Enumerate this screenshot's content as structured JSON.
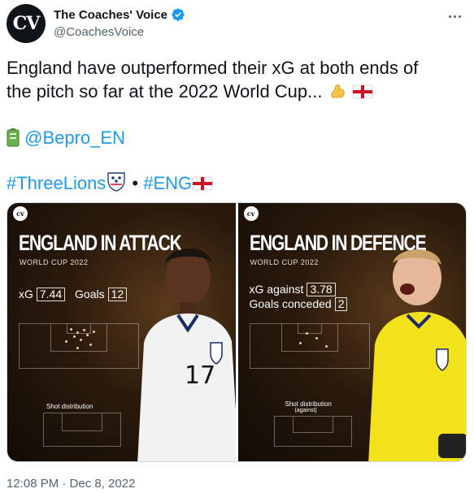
{
  "author": {
    "avatar_text": "CV",
    "display_name": "The Coaches' Voice",
    "handle": "@CoachesVoice"
  },
  "tweet": {
    "line1": "England have outperformed their xG at both ends of",
    "line2": "the pitch so far at the 2022 World Cup...",
    "mention": "@Bepro_EN",
    "hashtag1": "#ThreeLions",
    "separator": " • ",
    "hashtag2": "#ENG",
    "timestamp": "12:08 PM · Dec 8, 2022"
  },
  "media": {
    "attack": {
      "logo": "cv",
      "title": "ENGLAND IN ATTACK",
      "subtitle": "WORLD CUP 2022",
      "xg_label": "xG",
      "xg_value": "7.44",
      "goals_label": "Goals",
      "goals_value": "12",
      "shot_label": "Shot distribution"
    },
    "defence": {
      "logo": "cv",
      "title": "ENGLAND IN DEFENCE",
      "subtitle": "WORLD CUP 2022",
      "xg_label": "xG against",
      "xg_value": "3.78",
      "goals_label": "Goals conceded",
      "goals_value": "2",
      "shot_label": "Shot distribution",
      "shot_sub": "(against)"
    }
  },
  "colors": {
    "link": "#1d9bf0",
    "text": "#0f1419",
    "muted": "#536471"
  }
}
